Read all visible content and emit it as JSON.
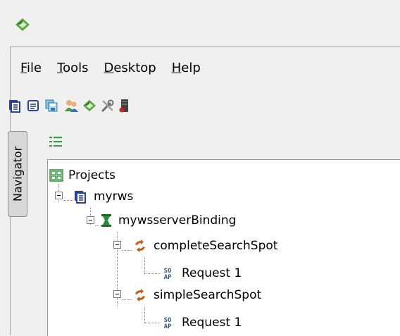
{
  "menu": {
    "items": [
      {
        "mnemonic": "F",
        "rest": "ile"
      },
      {
        "mnemonic": "T",
        "rest": "ools"
      },
      {
        "mnemonic": "D",
        "rest": "esktop"
      },
      {
        "mnemonic": "H",
        "rest": "elp"
      }
    ]
  },
  "toolbar": {
    "icons": [
      "new-project-icon",
      "import-project-icon",
      "save-all-icon",
      "users-icon",
      "soapui-icon",
      "preferences-icon",
      "server-icon"
    ]
  },
  "sidebar": {
    "navigator_tab": "Navigator"
  },
  "tree": {
    "root": "Projects",
    "project": "myrws",
    "binding": "mywsserverBinding",
    "operations": [
      {
        "name": "completeSearchSpot",
        "request": "Request 1"
      },
      {
        "name": "simpleSearchSpot",
        "request": "Request 1"
      }
    ]
  },
  "colors": {
    "accent_green": "#3a9a4a",
    "project_blue": "#2840a0",
    "operation_orange": "#c85a14"
  }
}
